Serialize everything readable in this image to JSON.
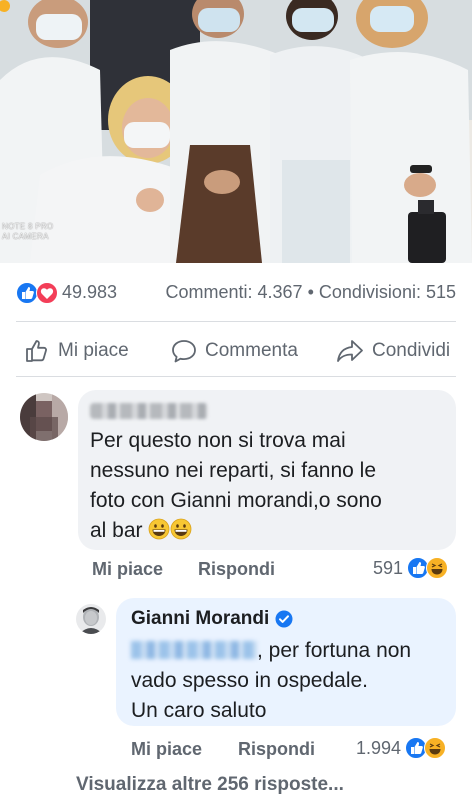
{
  "post": {
    "photo_watermark": [
      "NOTE 8 PRO",
      "AI CAMERA"
    ],
    "reaction_count": "49.983",
    "comments_label": "Commenti: 4.367",
    "separator": "•",
    "shares_label": "Condivisioni: 515",
    "reaction_icons": [
      "like-icon",
      "love-icon"
    ],
    "colors": {
      "like": "#1877f2",
      "love": "#f33e58",
      "haha": "#f7b125"
    }
  },
  "actions": {
    "like_label": "Mi piace",
    "comment_label": "Commenta",
    "share_label": "Condividi"
  },
  "comment": {
    "author_blurred": true,
    "lines": [
      "Per questo non si trova  mai",
      "nessuno nei reparti, si fanno le",
      "foto con Gianni morandi,o sono",
      "al bar"
    ],
    "emojis": [
      "grinning-face-icon",
      "grinning-face-icon"
    ],
    "like_label": "Mi piace",
    "reply_label": "Rispondi",
    "reaction_count": "591",
    "reaction_icons": [
      "like-icon",
      "haha-icon"
    ]
  },
  "reply": {
    "author": "Gianni Morandi",
    "verified": true,
    "lines": [
      ", per fortuna non",
      "vado spesso in ospedale.",
      "Un caro saluto"
    ],
    "like_label": "Mi piace",
    "reply_label": "Rispondi",
    "reaction_count": "1.994",
    "reaction_icons": [
      "like-icon",
      "haha-icon"
    ]
  },
  "more_replies": "Visualizza altre 256 risposte..."
}
